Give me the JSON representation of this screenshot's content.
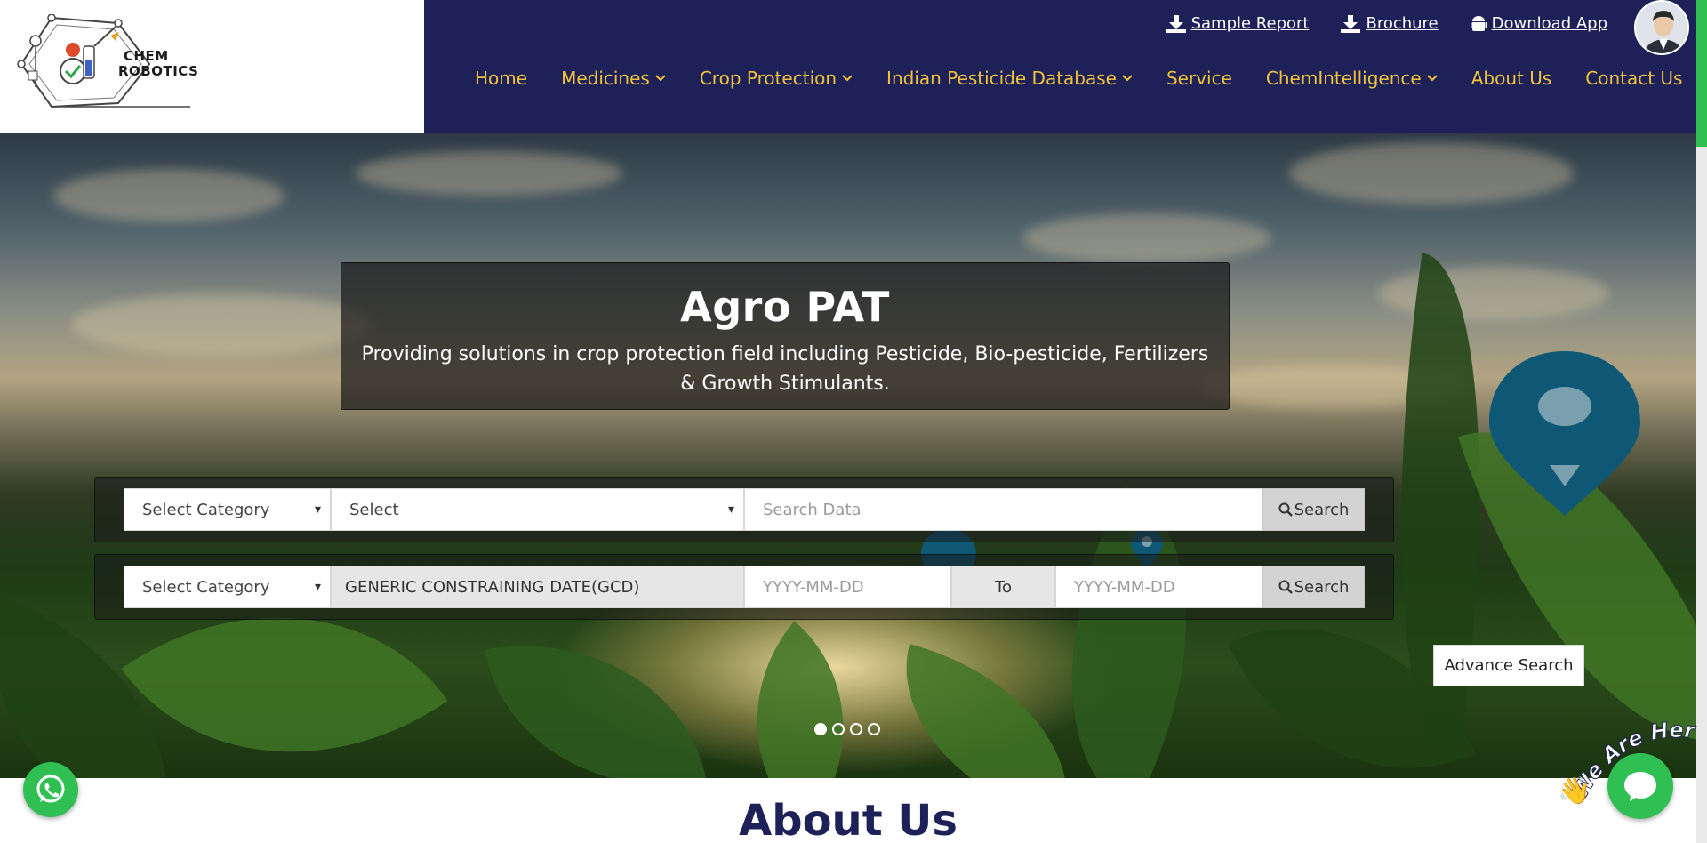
{
  "header": {
    "logo_text_line1": "CHEM",
    "logo_text_line2": "ROBOTICS",
    "top_links": [
      {
        "label": "Sample Report",
        "icon": "download-icon"
      },
      {
        "label": "Brochure",
        "icon": "download-icon"
      },
      {
        "label": "Download App",
        "icon": "android-icon"
      }
    ],
    "nav": [
      {
        "label": "Home",
        "dropdown": false
      },
      {
        "label": "Medicines",
        "dropdown": true
      },
      {
        "label": "Crop Protection",
        "dropdown": true
      },
      {
        "label": "Indian Pesticide Database",
        "dropdown": true
      },
      {
        "label": "Service",
        "dropdown": false
      },
      {
        "label": "ChemIntelligence",
        "dropdown": true
      },
      {
        "label": "About Us",
        "dropdown": false
      },
      {
        "label": "Contact Us",
        "dropdown": false
      }
    ]
  },
  "hero": {
    "title": "Agro PAT",
    "subtitle": "Providing solutions in crop protection field including Pesticide, Bio-pesticide, Fertilizers & Growth Stimulants.",
    "search1": {
      "category": "Select Category",
      "select": "Select",
      "placeholder": "Search Data",
      "button": "Search"
    },
    "search2": {
      "category": "Select Category",
      "field": "GENERIC CONSTRAINING DATE(GCD)",
      "from_placeholder": "YYYY-MM-DD",
      "to_label": "To",
      "to_placeholder": "YYYY-MM-DD",
      "button": "Search"
    },
    "advance_search": "Advance Search",
    "slides_total": 4,
    "slide_active": 1
  },
  "about": {
    "title": "About Us"
  },
  "chat_widget": {
    "label": "We Are Here!"
  },
  "colors": {
    "nav_bg": "#1d2158",
    "nav_link": "#f3c33c",
    "accent_green": "#2fbf52",
    "pin_blue": "#0e5775"
  }
}
